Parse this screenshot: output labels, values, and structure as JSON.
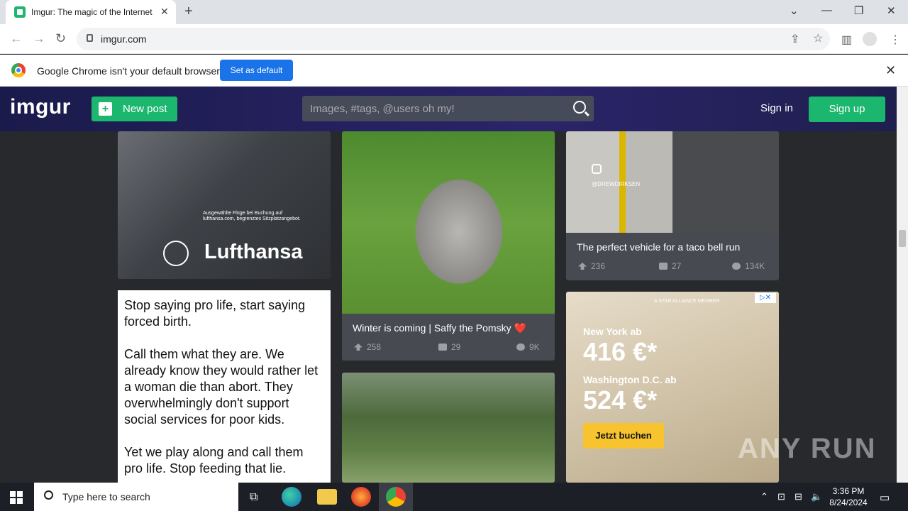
{
  "browser": {
    "tab_title": "Imgur: The magic of the Internet",
    "url": "imgur.com",
    "infobar_message": "Google Chrome isn't your default browser",
    "set_default_label": "Set as default"
  },
  "imgur": {
    "logo": "imgur",
    "new_post_label": "New post",
    "search_placeholder": "Images, #tags, @users oh my!",
    "sign_in_label": "Sign in",
    "sign_up_label": "Sign up"
  },
  "posts": {
    "lufthansa_ad": {
      "brand": "Lufthansa",
      "fineprint": "Ausgewählte Flüge bei Buchung auf lufthansa.com, begrenztes Sitzplatzangebot."
    },
    "text_post": {
      "lines": [
        "Stop saying pro life, start saying forced birth.",
        "Call them what they are. We already know they would rather let a woman die than abort. They overwhelmingly don't support social services for poor kids.",
        "Yet we play along and call them pro life. Stop feeding that lie."
      ]
    },
    "puppy": {
      "title": "Winter is coming | Saffy the Pomsky ❤️",
      "upvotes": "258",
      "comments": "29",
      "views": "9K"
    },
    "taco": {
      "watermark": "@DREWDIRKSEN",
      "title": "The perfect vehicle for a taco bell run",
      "upvotes": "236",
      "comments": "27",
      "views": "134K"
    },
    "travel_ad": {
      "member": "A STAR ALLIANCE MEMBER",
      "line1": "New York ab",
      "price1": "416 €*",
      "line2": "Washington D.C. ab",
      "price2": "524 €*",
      "cta": "Jetzt buchen"
    }
  },
  "taskbar": {
    "search_placeholder": "Type here to search",
    "time": "3:36 PM",
    "date": "8/24/2024"
  },
  "watermark": "ANY RUN"
}
